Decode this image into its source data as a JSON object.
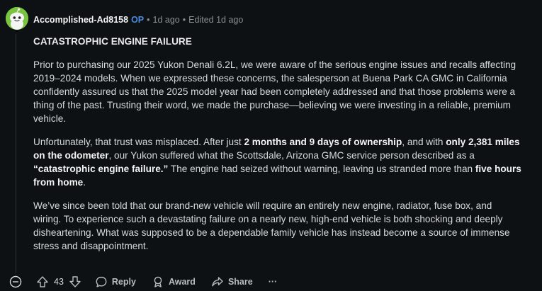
{
  "comment": {
    "author": "Accomplished-Ad8158",
    "op_badge": "OP",
    "separator1": "•",
    "age": "1d ago",
    "separator2": "•",
    "edited": "Edited 1d ago",
    "heading": "CATASTROPHIC ENGINE FAILURE",
    "p1": "Prior to purchasing our 2025 Yukon Denali 6.2L, we were aware of the serious engine issues and recalls affecting 2019–2024 models. When we expressed these concerns, the salesperson at Buena Park CA GMC in California confidently assured us that the 2025 model year had been completely addressed and that those problems were a thing of the past. Trusting their word, we made the purchase—believing we were investing in a reliable, premium vehicle.",
    "p2": {
      "a": "Unfortunately, that trust was misplaced. After just ",
      "b": "2 months and 9 days of ownership",
      "c": ", and with ",
      "d": "only 2,381 miles on the odometer",
      "e": ", our Yukon suffered what the Scottsdale, Arizona GMC service person described as a ",
      "f": "“catastrophic engine failure.”",
      "g": " The engine had seized without warning, leaving us stranded more than ",
      "h": "five hours from home",
      "i": "."
    },
    "p3": "We’ve since been told that our brand-new vehicle will require an entirely new engine, radiator, fuse box, and wiring. To experience such a devastating failure on a nearly new, high-end vehicle is both shocking and deeply disheartening. What was supposed to be a dependable family vehicle has instead become a source of immense stress and disappointment."
  },
  "actions": {
    "vote_count": "43",
    "reply_label": "Reply",
    "award_label": "Award",
    "share_label": "Share",
    "more_label": "···"
  },
  "colors": {
    "background": "#0e1113",
    "text": "#d7dadc",
    "op_badge": "#4a8be0",
    "avatar": "#79c441",
    "meta": "#8a8f94"
  },
  "icons": [
    "snoo-avatar-icon",
    "collapse-icon",
    "upvote-icon",
    "downvote-icon",
    "reply-icon",
    "award-icon",
    "share-icon",
    "more-icon"
  ]
}
